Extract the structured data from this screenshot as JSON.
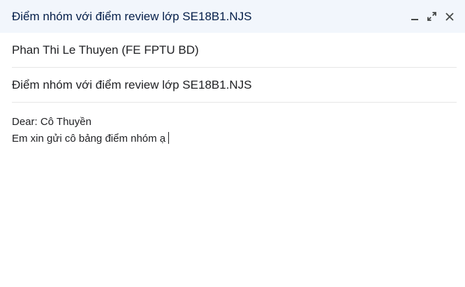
{
  "header": {
    "title": "Điểm nhóm với điểm review lớp SE18B1.NJS",
    "icons": [
      "minimize-icon",
      "expand-icon",
      "close-icon"
    ]
  },
  "recipient": {
    "value": "Phan Thi Le Thuyen (FE FPTU BD)"
  },
  "subject": {
    "value": "Điểm nhóm với điểm review lớp SE18B1.NJS"
  },
  "body": {
    "lines": [
      "Dear: Cô Thuyền",
      "Em xin gửi cô bảng điểm nhóm ạ"
    ]
  },
  "colors": {
    "header_bg": "#f2f6fc",
    "header_text": "#041e49",
    "divider": "#e6e6e6"
  }
}
